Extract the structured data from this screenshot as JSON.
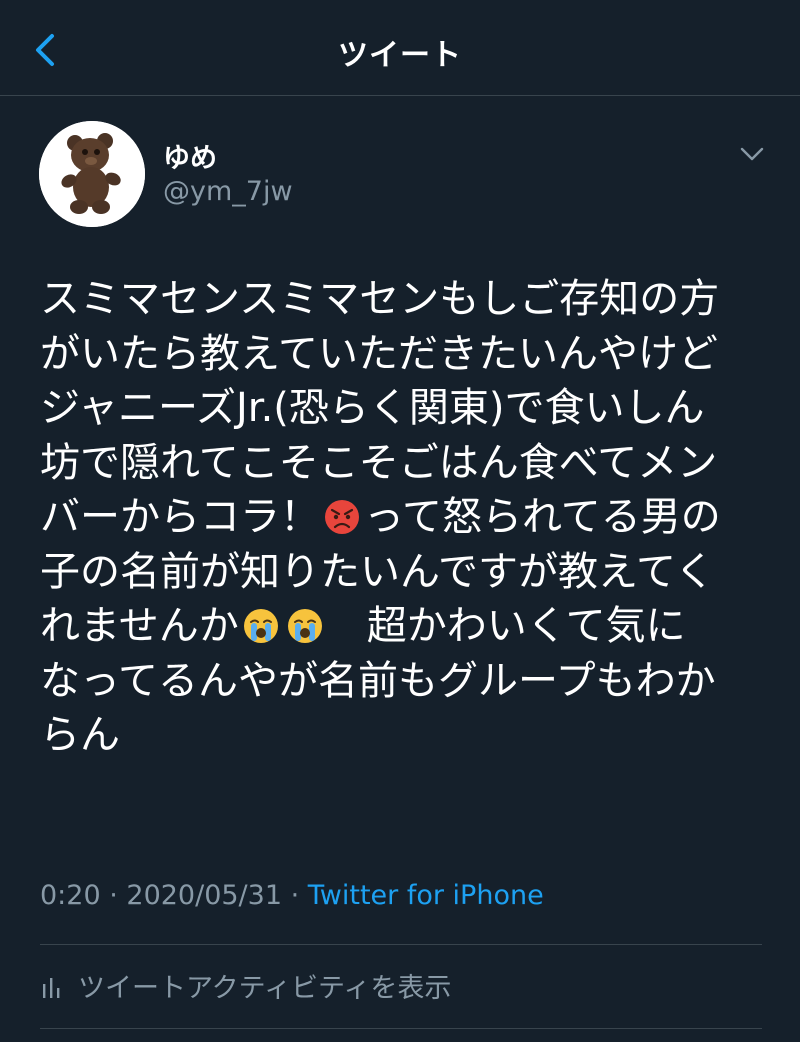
{
  "header": {
    "title": "ツイート",
    "back_icon": "chevron-left-icon"
  },
  "author": {
    "display_name": "ゆめ",
    "handle": "@ym_7jw",
    "avatar_icon": "teddy-bear-avatar"
  },
  "tweet": {
    "lines": [
      "スミマセンスミマセンもしご存知の方",
      "がいたら教えていただきたいんやけど",
      "ジャニーズJr.(恐らく関東)で食いしん",
      "坊で隠れてこそこそごはん食べてメン",
      "バーからコラ！",
      "って怒られてる男の",
      "子の名前が知りたいんですが教えてく",
      "れませんか",
      "　超かわいくて気に",
      "なってるんやが名前もグループもわか",
      "らん"
    ],
    "emojis": [
      "angry-face-emoji",
      "loudly-crying-face-emoji",
      "loudly-crying-face-emoji"
    ]
  },
  "meta": {
    "time": "0:20",
    "separator": " · ",
    "date": "2020/05/31",
    "separator2": " · ",
    "source": "Twitter for iPhone"
  },
  "activity": {
    "label": "ツイートアクティビティを表示",
    "icon": "bar-chart-icon"
  },
  "colors": {
    "background": "#15202b",
    "text": "#ffffff",
    "muted": "#8899a6",
    "accent": "#1da1f2",
    "divider": "#38444d"
  }
}
